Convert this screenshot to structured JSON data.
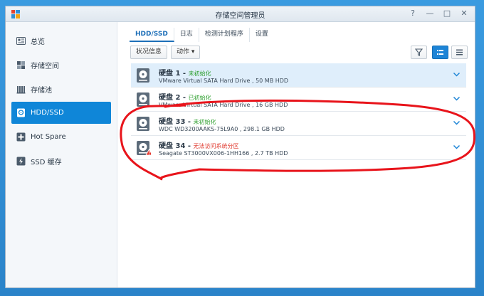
{
  "window": {
    "title": "存储空间管理员"
  },
  "title_controls": {
    "help": "?",
    "minimize": "—",
    "maximize": "□",
    "close": "✕"
  },
  "sidebar": {
    "items": [
      {
        "label": "总览",
        "icon": "overview-icon"
      },
      {
        "label": "存储空间",
        "icon": "volume-icon"
      },
      {
        "label": "存储池",
        "icon": "storage-pool-icon"
      },
      {
        "label": "HDD/SSD",
        "icon": "disk-icon",
        "active": true
      },
      {
        "label": "Hot Spare",
        "icon": "hot-spare-icon"
      },
      {
        "label": "SSD 缓存",
        "icon": "ssd-cache-icon"
      }
    ]
  },
  "tabs": [
    {
      "label": "HDD/SSD",
      "active": true
    },
    {
      "label": "日志"
    },
    {
      "label": "检测计划程序"
    },
    {
      "label": "设置"
    }
  ],
  "toolbar": {
    "status_label": "状况信息",
    "action_label": "动作 ▾",
    "icons": [
      "filter-icon",
      "list-view-icon",
      "detail-view-icon"
    ]
  },
  "disks": [
    {
      "name": "硬盘 1",
      "status": "未初始化",
      "status_color": "#2a9d2a",
      "desc": "VMware Virtual SATA Hard Drive , 50 MB HDD",
      "warning": false,
      "selected": true
    },
    {
      "name": "硬盘 2",
      "status": "已初始化",
      "status_color": "#2a9d2a",
      "desc": "VMware Virtual SATA Hard Drive , 16 GB HDD",
      "warning": false
    },
    {
      "name": "硬盘 33",
      "status": "未初始化",
      "status_color": "#2a9d2a",
      "desc": "WDC WD3200AAKS-75L9A0 , 298.1 GB HDD",
      "warning": false
    },
    {
      "name": "硬盘 34",
      "status": "无法访问系统分区",
      "status_color": "#e03a2f",
      "desc": "Seagate ST3000VX006-1HH166 , 2.7 TB HDD",
      "warning": true
    }
  ],
  "colors": {
    "accent": "#0f86d8",
    "annotation": "#e8141b"
  }
}
